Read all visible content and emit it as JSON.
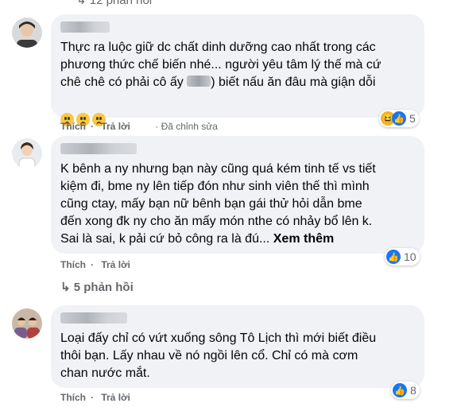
{
  "top_replies_label": "↳ 12 phản hồi",
  "actions": {
    "like": "Thích",
    "reply": "Trả lời",
    "edited": "· Đã chỉnh sửa"
  },
  "comments": [
    {
      "text_before": "Thực ra luộc giữ dc chất dinh dưỡng cao nhất trong các\nphương thức chế biến nhé... người yêu tâm lý thế mà cứ\nchê chê có phải cô ấy ",
      "text_after": ") biết nấu ăn đâu mà giận dỗi",
      "emojis": [
        "confused-emoji",
        "confused-emoji",
        "confused-emoji"
      ],
      "reaction_count": "5",
      "reactions": [
        "haha",
        "like"
      ]
    },
    {
      "text": "K bênh a ny nhưng bạn này cũng quá kém tinh tế vs tiết\nkiệm đi, bme ny lên tiếp đón như sinh viên thế thì mình\ncũng ctay, mấy bạn nữ bênh bạn gái thử hỏi dẫn bme\nđến xong đk ny cho ăn mấy món nthe có nhảy bổ lên k.\nSai là sai, k pải cứ bỏ công ra là đú...",
      "see_more": "Xem thêm",
      "reaction_count": "10",
      "reactions": [
        "like"
      ],
      "replies_label": "↳ 5 phản hồi"
    },
    {
      "text": "Loại đấy chỉ có vứt xuống sông Tô Lịch thì mới biết điều\nthôi bạn. Lấy nhau về nó ngồi lên cổ. Chỉ có mà cơm\nchan nước mắt.",
      "reaction_count": "8",
      "reactions": [
        "like"
      ]
    }
  ],
  "colors": {
    "bubble": "#f0f2f5",
    "meta": "#65676b",
    "like": "#1877f2",
    "haha": "#f7b125"
  }
}
